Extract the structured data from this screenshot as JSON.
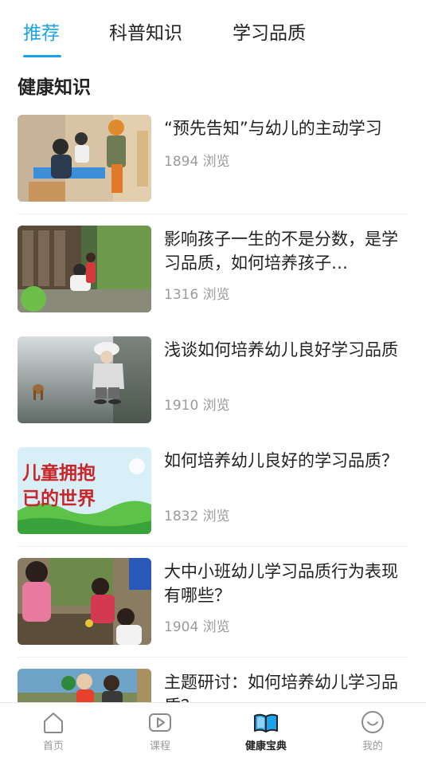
{
  "tabs": [
    {
      "label": "推荐",
      "active": true
    },
    {
      "label": "科普知识",
      "active": false
    },
    {
      "label": "学习品质",
      "active": false
    }
  ],
  "section_title": "健康知识",
  "articles": [
    {
      "title": "“预先告知”与幼儿的主动学习",
      "views": "1894 浏览"
    },
    {
      "title": "影响孩子一生的不是分数，是学习品质，如何培养孩子…",
      "views": "1316 浏览"
    },
    {
      "title": "浅谈如何培养幼儿良好学习品质",
      "views": "1910 浏览"
    },
    {
      "title": "如何培养幼儿良好的学习品质？",
      "views": "1832 浏览",
      "thumb_text": "儿童拥抱已的世界"
    },
    {
      "title": "大中小班幼儿学习品质行为表现有哪些？",
      "views": "1904 浏览"
    },
    {
      "title": "主题研讨：如何培养幼儿学习品质？",
      "views": ""
    }
  ],
  "bottom_nav": [
    {
      "label": "首页",
      "icon": "home-icon",
      "active": false
    },
    {
      "label": "课程",
      "icon": "play-icon",
      "active": false
    },
    {
      "label": "健康宝典",
      "icon": "book-icon",
      "active": true
    },
    {
      "label": "我的",
      "icon": "smile-icon",
      "active": false
    }
  ],
  "colors": {
    "accent": "#1aa3e8",
    "muted": "#9a9a9a"
  }
}
